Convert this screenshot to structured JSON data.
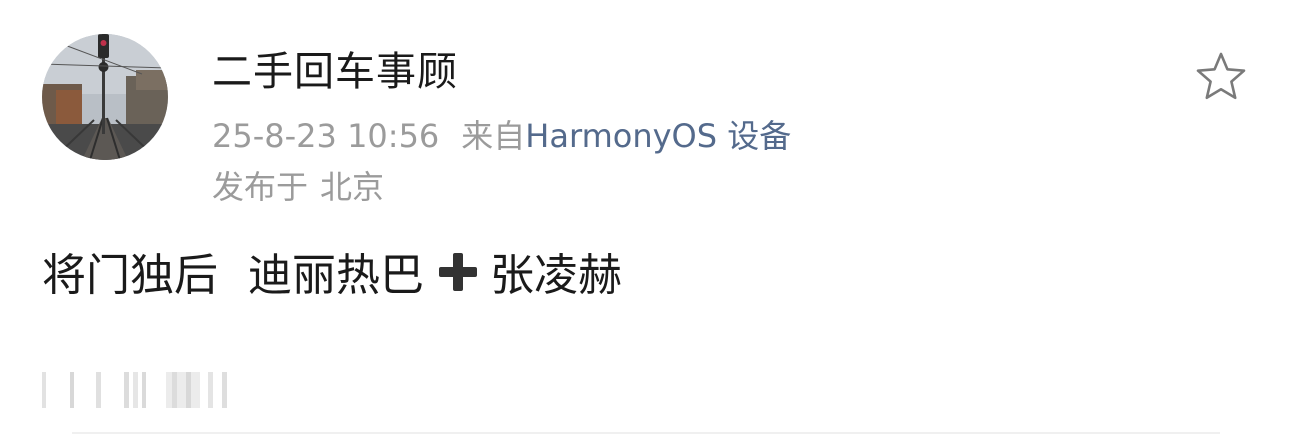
{
  "post": {
    "username": "二手回车事顾",
    "date": "25-8-23 10:56",
    "source_prefix": "来自",
    "source_device": "HarmonyOS 设备",
    "location_prefix": "发布于",
    "location": "北京",
    "content_part1": "将门独后",
    "content_part2": "迪丽热巴",
    "content_part3": "张凌赫"
  },
  "icons": {
    "favorite": "star-outline-icon",
    "content_emoji": "heavy-plus-icon"
  },
  "colors": {
    "username": "#1a1a1a",
    "meta": "#9b9b9b",
    "device_link": "#546a8c",
    "content": "#1a1a1a",
    "plus_emoji": "#333333"
  }
}
